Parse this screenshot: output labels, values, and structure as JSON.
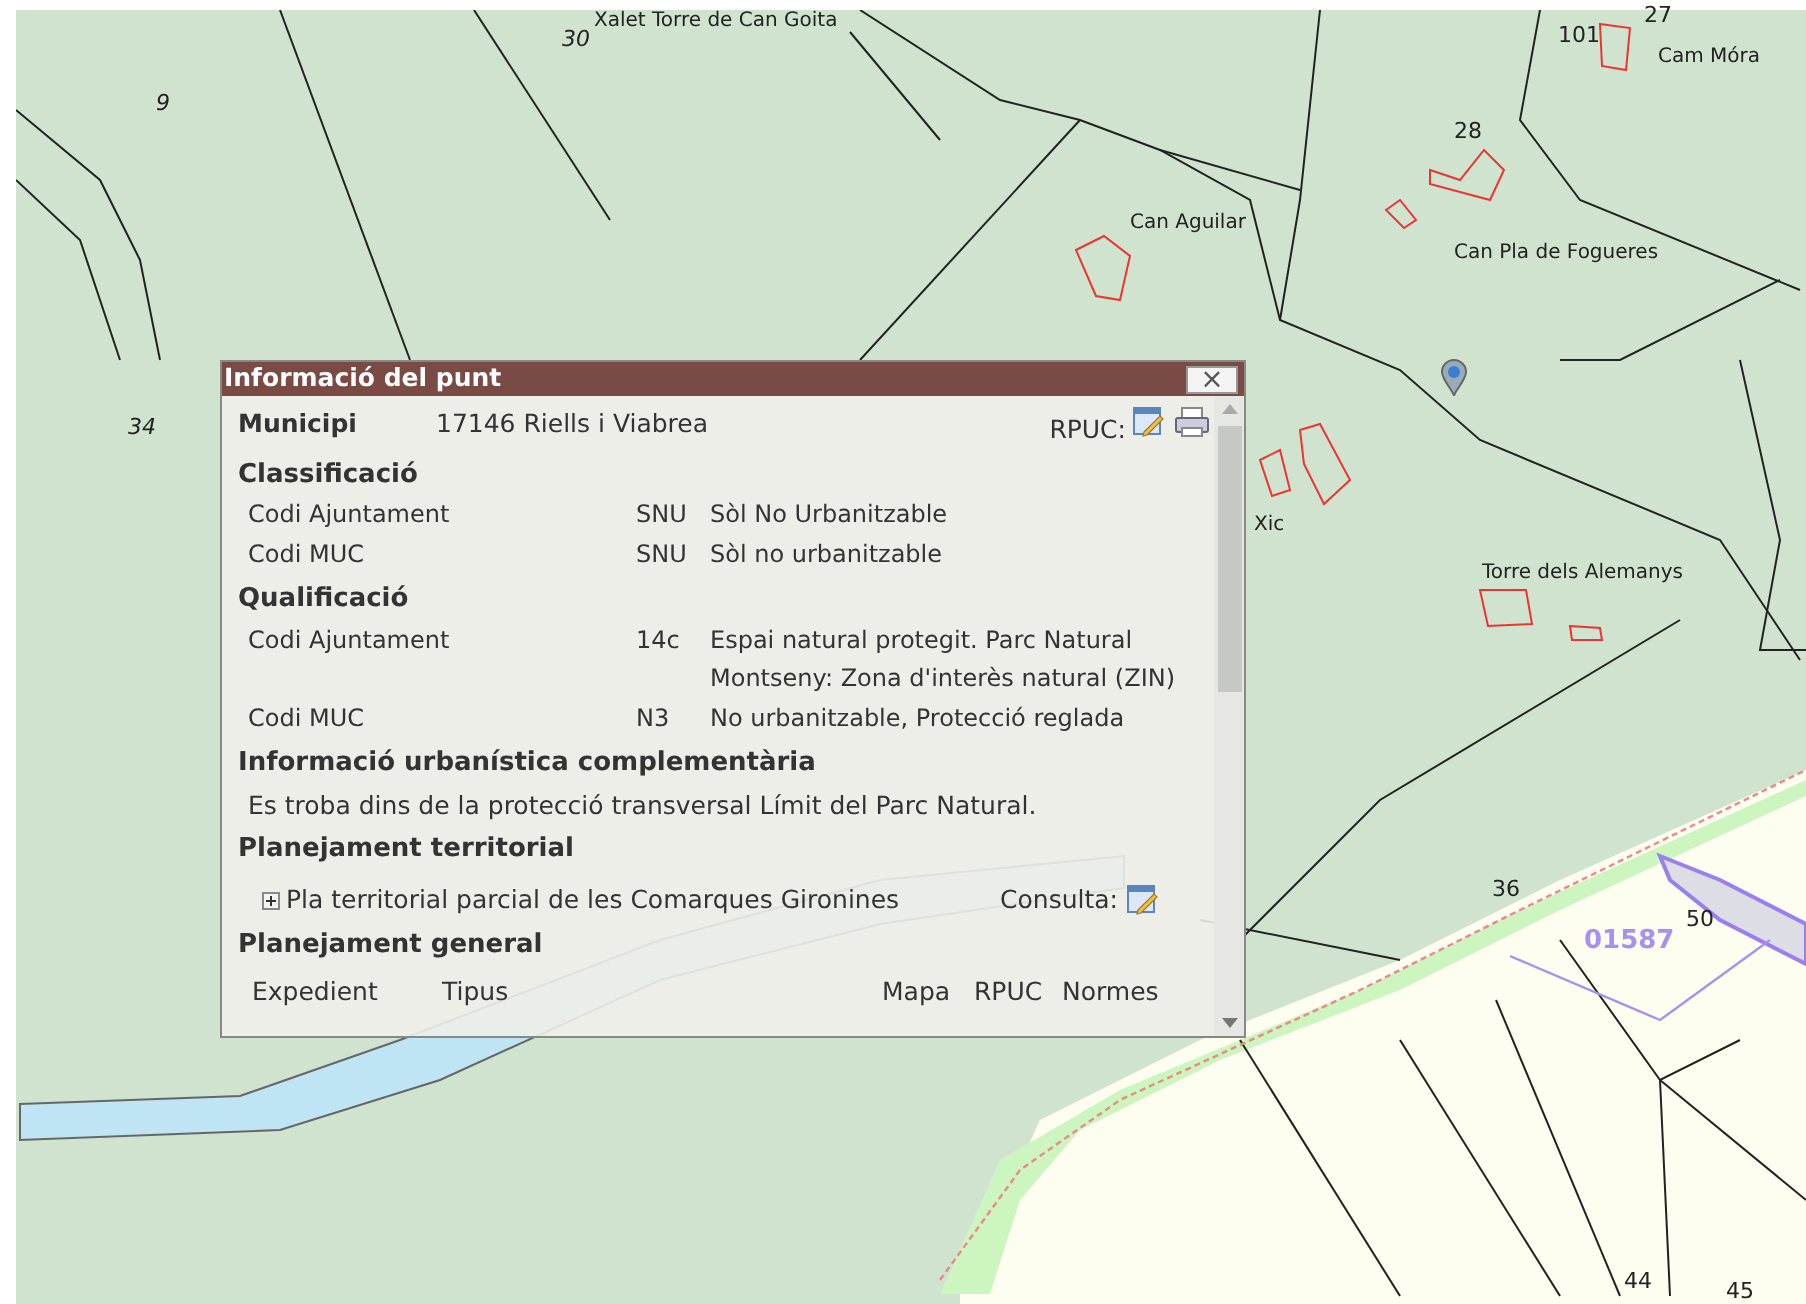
{
  "map": {
    "labels": [
      {
        "text": "Xalet Torre de Can Goita",
        "kind": "place"
      },
      {
        "text": "30",
        "kind": "italic"
      },
      {
        "text": "9",
        "kind": "italic"
      },
      {
        "text": "34",
        "kind": "italic"
      },
      {
        "text": "101",
        "kind": "number"
      },
      {
        "text": "27",
        "kind": "number"
      },
      {
        "text": "Cam Móra",
        "kind": "place"
      },
      {
        "text": "28",
        "kind": "number"
      },
      {
        "text": "Can Aguilar",
        "kind": "place"
      },
      {
        "text": "Can Pla de Fogueres",
        "kind": "place"
      },
      {
        "text": "Xic",
        "kind": "place"
      },
      {
        "text": "Torre dels Alemanys",
        "kind": "place"
      },
      {
        "text": "36",
        "kind": "number"
      },
      {
        "text": "50",
        "kind": "number"
      },
      {
        "text": "01587",
        "kind": "sector"
      },
      {
        "text": "44",
        "kind": "number"
      },
      {
        "text": "45",
        "kind": "number"
      }
    ]
  },
  "popup": {
    "title": "Informació del punt",
    "close": "×",
    "municipi": {
      "label": "Municipi",
      "value": "17146 Riells i Viabrea"
    },
    "rpuc_label": "RPUC:",
    "sections": [
      {
        "kind": "table",
        "title": "Classificació",
        "rows": [
          {
            "label": "Codi Ajuntament",
            "code": "SNU",
            "description": "Sòl No Urbanitzable"
          },
          {
            "label": "Codi MUC",
            "code": "SNU",
            "description": "Sòl no urbanitzable"
          }
        ]
      },
      {
        "kind": "table",
        "title": "Qualificació",
        "rows": [
          {
            "label": "Codi Ajuntament",
            "code": "14c",
            "description": "Espai natural protegit. Parc Natural Montseny: Zona d'interès natural (ZIN)"
          },
          {
            "label": "Codi MUC",
            "code": "N3",
            "description": "No urbanitzable, Protecció reglada"
          }
        ]
      },
      {
        "kind": "text",
        "title": "Informació urbanística complementària",
        "text": "Es troba dins de la protecció transversal Límit del Parc Natural."
      },
      {
        "kind": "plan",
        "title": "Planejament territorial",
        "items": [
          {
            "label": "Pla territorial parcial de les Comarques Gironines",
            "expanded": false,
            "consult": "Consulta:"
          }
        ]
      },
      {
        "kind": "columns",
        "title": "Planejament general",
        "columns": [
          "Expedient",
          "Tipus",
          "Mapa",
          "RPUC",
          "Normes"
        ]
      }
    ]
  }
}
